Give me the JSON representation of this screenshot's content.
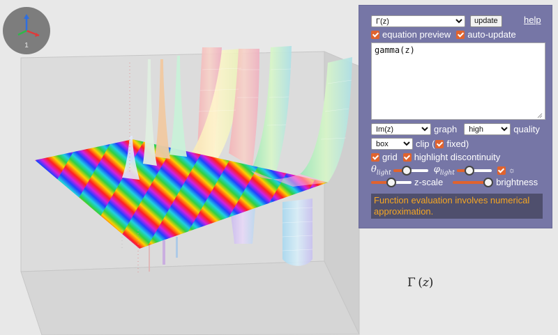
{
  "viewer": {
    "axis_indicator_label": "1",
    "plot": "3D surface of Im(Γ(z)) with rainbow phase coloring"
  },
  "panel": {
    "function_select": {
      "selected": "Γ(z)"
    },
    "update_button": "update",
    "help_link": "help",
    "equation_preview": {
      "label": "equation preview",
      "checked": true
    },
    "auto_update": {
      "label": "auto-update",
      "checked": true
    },
    "equation_text": "gamma(z)",
    "graph_select": {
      "selected": "Im(z)"
    },
    "graph_label": "graph",
    "quality_select": {
      "selected": "high"
    },
    "quality_label": "quality",
    "clip_select": {
      "selected": "box"
    },
    "clip_label": "clip (",
    "fixed": {
      "label": "fixed)",
      "checked": true
    },
    "grid": {
      "label": "grid",
      "checked": true
    },
    "highlight_discontinuity": {
      "label": "highlight discontinuity",
      "checked": true
    },
    "theta_light": {
      "symbol": "θ",
      "sub": "light",
      "value": 0.35
    },
    "phi_light": {
      "symbol": "φ",
      "sub": "light",
      "value": 0.3
    },
    "sun_toggle": {
      "label": "☼",
      "checked": true
    },
    "z_scale": {
      "label": "z-scale",
      "value": 0.5
    },
    "brightness": {
      "label": "brightness",
      "value": 1.0
    },
    "note": "Function evaluation involves numerical approximation."
  },
  "formula": {
    "symbol": "Γ",
    "argument": "z"
  },
  "colors": {
    "panel_bg": "#7676a6",
    "checkbox": "#e0632e",
    "slider_track": "#e0632e",
    "note_text": "#f5a623",
    "note_bg": "#4f4f6d"
  }
}
